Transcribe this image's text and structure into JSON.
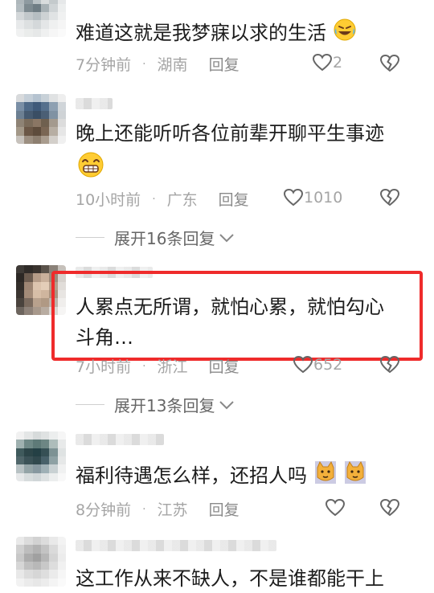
{
  "comments": [
    {
      "text": "难道这就是我梦寐以求的生活",
      "emoji": "rofl-emoji",
      "time": "7分钟前",
      "location": "湖南",
      "reply_label": "回复",
      "likes": "2"
    },
    {
      "text": "晚上还能听听各位前辈开聊平生事迹",
      "emoji": "grin-emoji",
      "time": "10小时前",
      "location": "广东",
      "reply_label": "回复",
      "likes": "1010",
      "expand_label": "展开16条回复"
    },
    {
      "text_line1": "人累点无所谓，就怕心累，就怕勾心",
      "text_line2": "斗角…",
      "time": "7小时前",
      "location": "浙江",
      "reply_label": "回复",
      "likes": "652",
      "expand_label": "展开13条回复",
      "highlight_color": "#ef2b2b"
    },
    {
      "text": "福利待遇怎么样，还招人吗",
      "emoji": "cat-emoji",
      "time": "8分钟前",
      "location": "江苏",
      "reply_label": "回复",
      "likes": ""
    },
    {
      "text": "这工作从来不缺人，不是谁都能干上",
      "time": "",
      "location": "",
      "reply_label": "",
      "likes": ""
    }
  ],
  "meta_dot": "·"
}
